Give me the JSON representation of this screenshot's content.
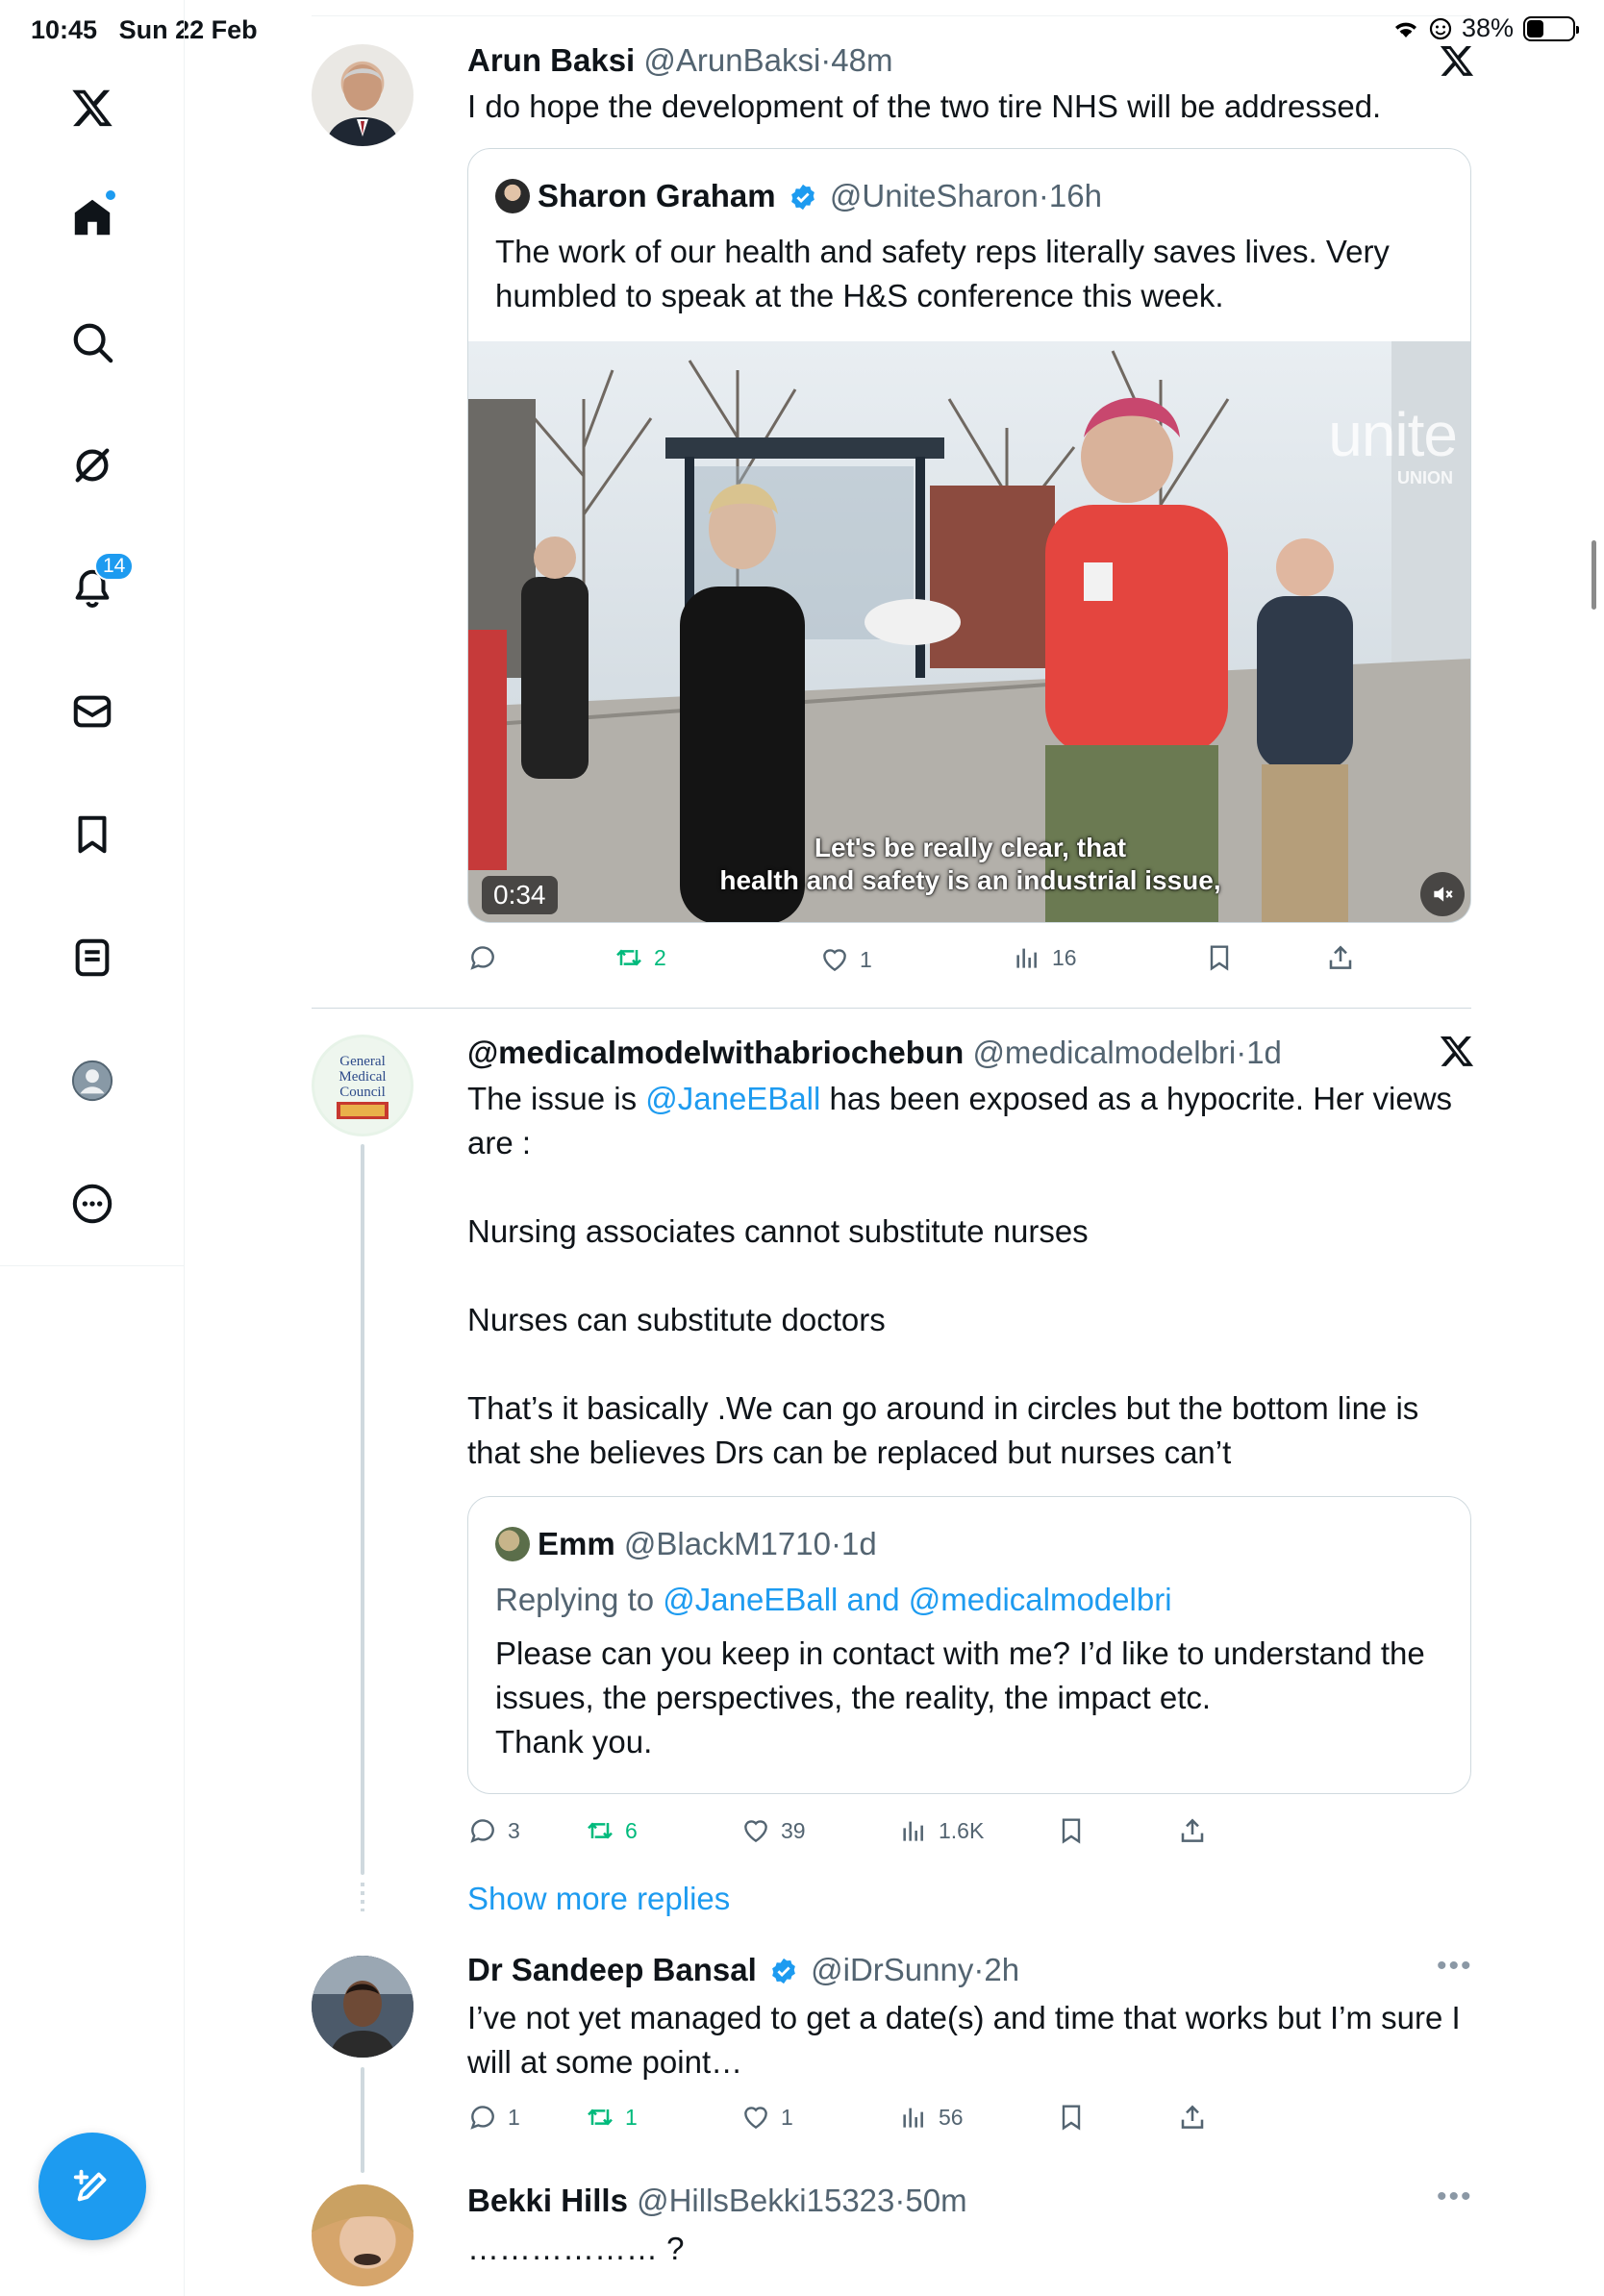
{
  "status": {
    "time": "10:45",
    "date": "Sun 22 Feb",
    "battery": "38%"
  },
  "sidebar": {
    "notifications_badge": "14"
  },
  "tweets": [
    {
      "name": "Arun Baksi",
      "handle": "@ArunBaksi",
      "time": "48m",
      "text": "I do hope the development of the two tire NHS will be addressed.",
      "quote": {
        "name": "Sharon Graham",
        "handle": "@UniteSharon",
        "time": "16h",
        "text": "The work of our health and safety reps literally saves lives. Very humbled to speak at the H&S conference this week.",
        "video_duration": "0:34",
        "caption_line1": "Let's be really clear, that",
        "caption_line2": "health and safety is an industrial issue,",
        "watermark": "unite",
        "watermark_sub": "UNION"
      },
      "stats": {
        "replies": "",
        "retweets": "2",
        "likes": "1",
        "views": "16"
      }
    },
    {
      "name": "@medicalmodelwithabriochebun",
      "handle": "@medicalmodelbri",
      "time": "1d",
      "text_p1_pre": "The issue is ",
      "text_p1_link": "@JaneEBall",
      "text_p1_post": " has been exposed as a hypocrite. Her views are :",
      "text_p2": "Nursing associates cannot substitute nurses",
      "text_p3": "Nurses can substitute doctors",
      "text_p4": "That’s it basically .We can go around in circles but the bottom line is that she believes Drs can be replaced but nurses can’t",
      "quote": {
        "name": "Emm",
        "handle": "@BlackM1710",
        "time": "1d",
        "replying_prefix": "Replying to ",
        "replying_to": "@JaneEBall and @medicalmodelbri",
        "text_l1": "Please can you keep in contact with me? I’d like to understand the issues, the perspectives, the reality, the impact etc.",
        "text_l2": "Thank you."
      },
      "stats": {
        "replies": "3",
        "retweets": "6",
        "likes": "39",
        "views": "1.6K"
      }
    },
    {
      "name": "Dr Sandeep Bansal",
      "handle": "@iDrSunny",
      "time": "2h",
      "text": "I’ve not yet managed to get a date(s) and time that works but I’m sure I will at some point…",
      "stats": {
        "replies": "1",
        "retweets": "1",
        "likes": "1",
        "views": "56"
      }
    },
    {
      "name": "Bekki Hills",
      "handle": "@HillsBekki15323",
      "time": "50m",
      "text": "……………… ?"
    }
  ],
  "show_more_replies": "Show more replies",
  "separator": "·",
  "icons": {
    "brand": "x-logo-icon",
    "home": "home-icon",
    "search": "search-icon",
    "grok": "grok-icon",
    "notifications": "bell-icon",
    "messages": "envelope-icon",
    "bookmarks": "bookmark-icon",
    "lists": "list-icon",
    "profile": "profile-icon",
    "more": "more-icon",
    "compose": "compose-icon"
  },
  "colors": {
    "accent": "#1d9bf0",
    "retweet": "#00ba7c",
    "muted": "#536471"
  }
}
